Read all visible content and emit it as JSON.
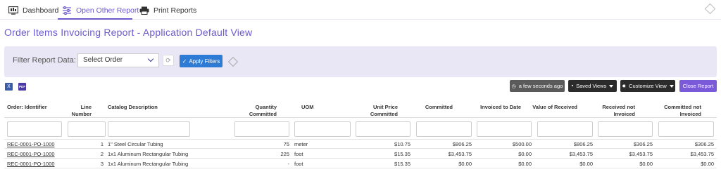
{
  "nav": {
    "dashboard": "Dashboard",
    "open_other_report": "Open Other Report",
    "print_reports": "Print Reports"
  },
  "page_title": "Order Items Invoicing Report - Application Default View",
  "filter": {
    "label": "Filter Report Data:",
    "select_value": "Select Order",
    "apply_label": "Apply Filters"
  },
  "toolbar": {
    "refresh_label": "a few seconds ago",
    "saved_views_label": "Saved Views",
    "customize_view_label": "Customize View",
    "close_report_label": "Close Report"
  },
  "export": {
    "excel": "X",
    "pdf": "PDF"
  },
  "table": {
    "headers": {
      "order_identifier": "Order: Identifier",
      "line_number": [
        "Line",
        "Number"
      ],
      "catalog_description": "Catalog Description",
      "quantity_committed": [
        "Quantity",
        "Committed"
      ],
      "uom": "UOM",
      "unit_price_committed": [
        "Unit Price",
        "Committed"
      ],
      "committed": "Committed",
      "invoiced_to_date": "Invoiced to Date",
      "value_of_received": "Value of Received",
      "received_not_invoiced": [
        "Received not",
        "Invoiced"
      ],
      "committed_not_invoiced": [
        "Committed not",
        "Invoiced"
      ]
    },
    "rows": [
      {
        "order_identifier": "REC-0001-PO-1000",
        "line_number": "1",
        "catalog_description": "1\" Steel Circular Tubing",
        "quantity_committed": "75",
        "uom": "meter",
        "unit_price_committed": "$10.75",
        "committed": "$806.25",
        "invoiced_to_date": "$500.00",
        "value_of_received": "$806.25",
        "received_not_invoiced": "$306.25",
        "committed_not_invoiced": "$306.25"
      },
      {
        "order_identifier": "REC-0001-PO-1000",
        "line_number": "2",
        "catalog_description": "1x1 Aluminum Rectangular Tubing",
        "quantity_committed": "225",
        "uom": "foot",
        "unit_price_committed": "$15.35",
        "committed": "$3,453.75",
        "invoiced_to_date": "$0.00",
        "value_of_received": "$3,453.75",
        "received_not_invoiced": "$3,453.75",
        "committed_not_invoiced": "$3,453.75"
      },
      {
        "order_identifier": "REC-0001-PO-1000",
        "line_number": "3",
        "catalog_description": "1x1 Aluminum Rectangular Tubing",
        "quantity_committed": "-",
        "uom": "foot",
        "unit_price_committed": "$15.35",
        "committed": "$0.00",
        "invoiced_to_date": "$0.00",
        "value_of_received": "$0.00",
        "received_not_invoiced": "$0.00",
        "committed_not_invoiced": "$0.00"
      }
    ]
  },
  "colors": {
    "accent": "#6a5acd",
    "apply_button": "#2e7bd6",
    "close_button": "#7a5ad8",
    "filter_band": "#e9e7f5"
  }
}
